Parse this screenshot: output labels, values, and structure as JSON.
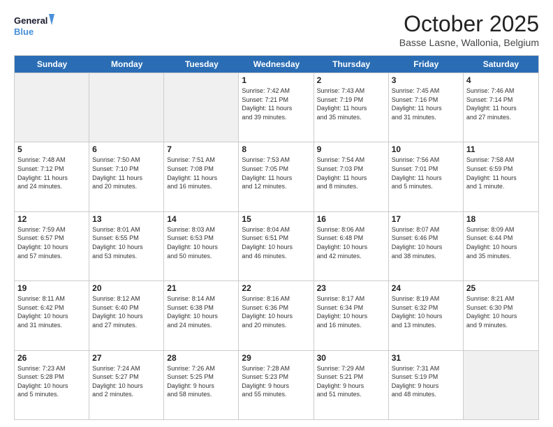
{
  "logo": {
    "line1": "General",
    "line2": "Blue"
  },
  "title": "October 2025",
  "location": "Basse Lasne, Wallonia, Belgium",
  "days_of_week": [
    "Sunday",
    "Monday",
    "Tuesday",
    "Wednesday",
    "Thursday",
    "Friday",
    "Saturday"
  ],
  "weeks": [
    [
      {
        "day": "",
        "info": "",
        "empty": true
      },
      {
        "day": "",
        "info": "",
        "empty": true
      },
      {
        "day": "",
        "info": "",
        "empty": true
      },
      {
        "day": "1",
        "info": "Sunrise: 7:42 AM\nSunset: 7:21 PM\nDaylight: 11 hours\nand 39 minutes."
      },
      {
        "day": "2",
        "info": "Sunrise: 7:43 AM\nSunset: 7:19 PM\nDaylight: 11 hours\nand 35 minutes."
      },
      {
        "day": "3",
        "info": "Sunrise: 7:45 AM\nSunset: 7:16 PM\nDaylight: 11 hours\nand 31 minutes."
      },
      {
        "day": "4",
        "info": "Sunrise: 7:46 AM\nSunset: 7:14 PM\nDaylight: 11 hours\nand 27 minutes."
      }
    ],
    [
      {
        "day": "5",
        "info": "Sunrise: 7:48 AM\nSunset: 7:12 PM\nDaylight: 11 hours\nand 24 minutes."
      },
      {
        "day": "6",
        "info": "Sunrise: 7:50 AM\nSunset: 7:10 PM\nDaylight: 11 hours\nand 20 minutes."
      },
      {
        "day": "7",
        "info": "Sunrise: 7:51 AM\nSunset: 7:08 PM\nDaylight: 11 hours\nand 16 minutes."
      },
      {
        "day": "8",
        "info": "Sunrise: 7:53 AM\nSunset: 7:05 PM\nDaylight: 11 hours\nand 12 minutes."
      },
      {
        "day": "9",
        "info": "Sunrise: 7:54 AM\nSunset: 7:03 PM\nDaylight: 11 hours\nand 8 minutes."
      },
      {
        "day": "10",
        "info": "Sunrise: 7:56 AM\nSunset: 7:01 PM\nDaylight: 11 hours\nand 5 minutes."
      },
      {
        "day": "11",
        "info": "Sunrise: 7:58 AM\nSunset: 6:59 PM\nDaylight: 11 hours\nand 1 minute."
      }
    ],
    [
      {
        "day": "12",
        "info": "Sunrise: 7:59 AM\nSunset: 6:57 PM\nDaylight: 10 hours\nand 57 minutes."
      },
      {
        "day": "13",
        "info": "Sunrise: 8:01 AM\nSunset: 6:55 PM\nDaylight: 10 hours\nand 53 minutes."
      },
      {
        "day": "14",
        "info": "Sunrise: 8:03 AM\nSunset: 6:53 PM\nDaylight: 10 hours\nand 50 minutes."
      },
      {
        "day": "15",
        "info": "Sunrise: 8:04 AM\nSunset: 6:51 PM\nDaylight: 10 hours\nand 46 minutes."
      },
      {
        "day": "16",
        "info": "Sunrise: 8:06 AM\nSunset: 6:48 PM\nDaylight: 10 hours\nand 42 minutes."
      },
      {
        "day": "17",
        "info": "Sunrise: 8:07 AM\nSunset: 6:46 PM\nDaylight: 10 hours\nand 38 minutes."
      },
      {
        "day": "18",
        "info": "Sunrise: 8:09 AM\nSunset: 6:44 PM\nDaylight: 10 hours\nand 35 minutes."
      }
    ],
    [
      {
        "day": "19",
        "info": "Sunrise: 8:11 AM\nSunset: 6:42 PM\nDaylight: 10 hours\nand 31 minutes."
      },
      {
        "day": "20",
        "info": "Sunrise: 8:12 AM\nSunset: 6:40 PM\nDaylight: 10 hours\nand 27 minutes."
      },
      {
        "day": "21",
        "info": "Sunrise: 8:14 AM\nSunset: 6:38 PM\nDaylight: 10 hours\nand 24 minutes."
      },
      {
        "day": "22",
        "info": "Sunrise: 8:16 AM\nSunset: 6:36 PM\nDaylight: 10 hours\nand 20 minutes."
      },
      {
        "day": "23",
        "info": "Sunrise: 8:17 AM\nSunset: 6:34 PM\nDaylight: 10 hours\nand 16 minutes."
      },
      {
        "day": "24",
        "info": "Sunrise: 8:19 AM\nSunset: 6:32 PM\nDaylight: 10 hours\nand 13 minutes."
      },
      {
        "day": "25",
        "info": "Sunrise: 8:21 AM\nSunset: 6:30 PM\nDaylight: 10 hours\nand 9 minutes."
      }
    ],
    [
      {
        "day": "26",
        "info": "Sunrise: 7:23 AM\nSunset: 5:28 PM\nDaylight: 10 hours\nand 5 minutes."
      },
      {
        "day": "27",
        "info": "Sunrise: 7:24 AM\nSunset: 5:27 PM\nDaylight: 10 hours\nand 2 minutes."
      },
      {
        "day": "28",
        "info": "Sunrise: 7:26 AM\nSunset: 5:25 PM\nDaylight: 9 hours\nand 58 minutes."
      },
      {
        "day": "29",
        "info": "Sunrise: 7:28 AM\nSunset: 5:23 PM\nDaylight: 9 hours\nand 55 minutes."
      },
      {
        "day": "30",
        "info": "Sunrise: 7:29 AM\nSunset: 5:21 PM\nDaylight: 9 hours\nand 51 minutes."
      },
      {
        "day": "31",
        "info": "Sunrise: 7:31 AM\nSunset: 5:19 PM\nDaylight: 9 hours\nand 48 minutes."
      },
      {
        "day": "",
        "info": "",
        "empty": true
      }
    ]
  ]
}
